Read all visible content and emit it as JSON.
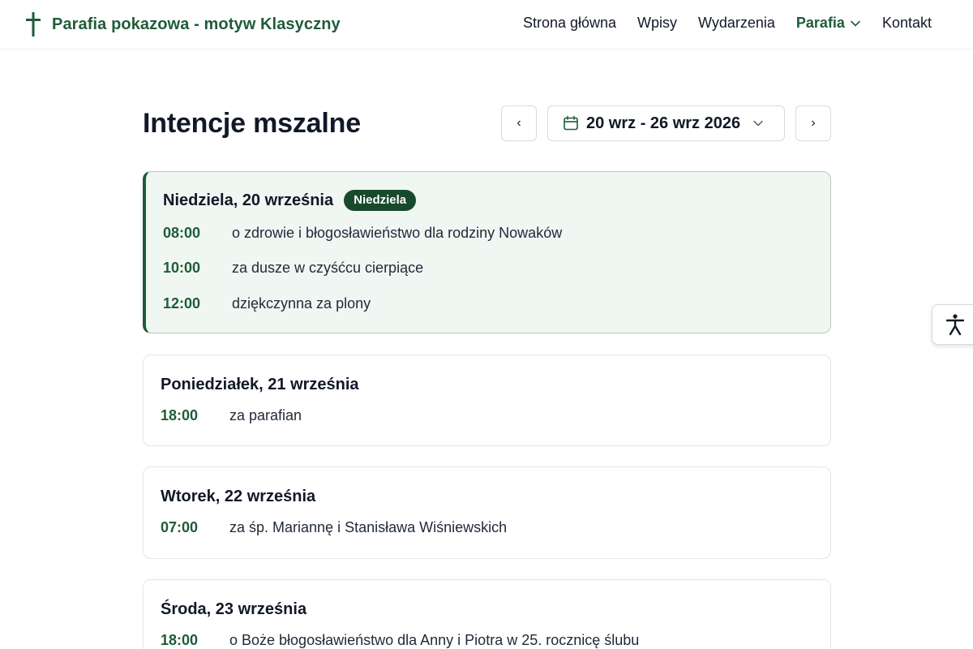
{
  "header": {
    "title": "Parafia pokazowa - motyw Klasyczny",
    "nav": [
      "Strona główna",
      "Wpisy",
      "Wydarzenia",
      "Parafia",
      "Kontakt"
    ]
  },
  "page": {
    "title": "Intencje mszalne",
    "prev_label": "‹",
    "next_label": "›",
    "date_range": "20 wrz - 26 wrz 2026"
  },
  "days": [
    {
      "title": "Niedziela, 20 września",
      "badge": "Niedziela",
      "masses": [
        {
          "time": "08:00",
          "text": "o zdrowie i błogosławieństwo dla rodziny Nowaków"
        },
        {
          "time": "10:00",
          "text": "za dusze w czyśćcu cierpiące"
        },
        {
          "time": "12:00",
          "text": "dziękczynna za plony"
        }
      ]
    },
    {
      "title": "Poniedziałek, 21 września",
      "masses": [
        {
          "time": "18:00",
          "text": "za parafian"
        }
      ]
    },
    {
      "title": "Wtorek, 22 września",
      "masses": [
        {
          "time": "07:00",
          "text": "za śp. Mariannę i Stanisława Wiśniewskich"
        }
      ]
    },
    {
      "title": "Środa, 23 września",
      "masses": [
        {
          "time": "18:00",
          "text": "o Boże błogosławieństwo dla Anny i Piotra w 25. rocznicę ślubu"
        }
      ]
    }
  ],
  "colors": {
    "accent": "#1f5c38",
    "badge": "#174a2c",
    "highlight_bg": "#f0f6f2"
  },
  "icons": [
    "cross-icon",
    "chevron-down-icon",
    "calendar-icon",
    "accessibility-icon"
  ]
}
